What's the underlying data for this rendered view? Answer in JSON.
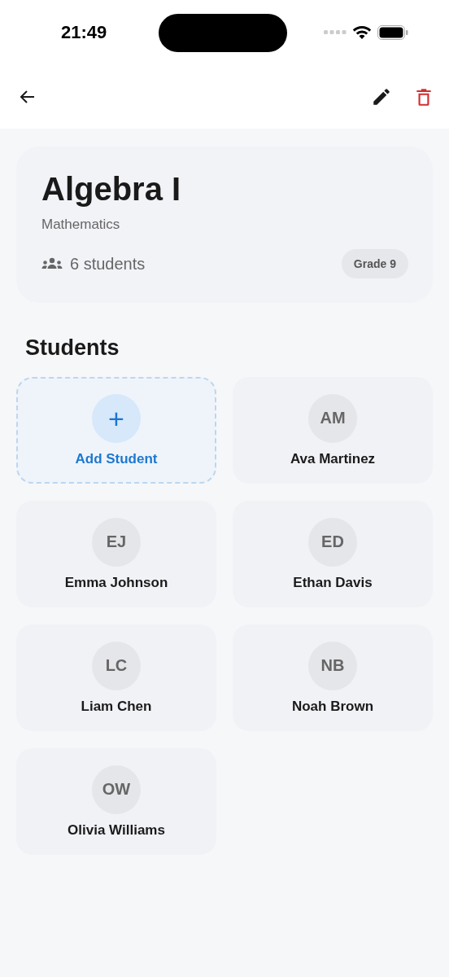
{
  "status_bar": {
    "time": "21:49"
  },
  "course": {
    "title": "Algebra I",
    "subject": "Mathematics",
    "student_count": "6 students",
    "grade": "Grade 9"
  },
  "section_title": "Students",
  "tiles": [
    {
      "kind": "add",
      "icon": "+",
      "label": "Add Student"
    },
    {
      "kind": "student",
      "initials": "AM",
      "name": "Ava Martinez"
    },
    {
      "kind": "student",
      "initials": "EJ",
      "name": "Emma Johnson"
    },
    {
      "kind": "student",
      "initials": "ED",
      "name": "Ethan Davis"
    },
    {
      "kind": "student",
      "initials": "LC",
      "name": "Liam Chen"
    },
    {
      "kind": "student",
      "initials": "NB",
      "name": "Noah Brown"
    },
    {
      "kind": "student",
      "initials": "OW",
      "name": "Olivia Williams"
    }
  ]
}
